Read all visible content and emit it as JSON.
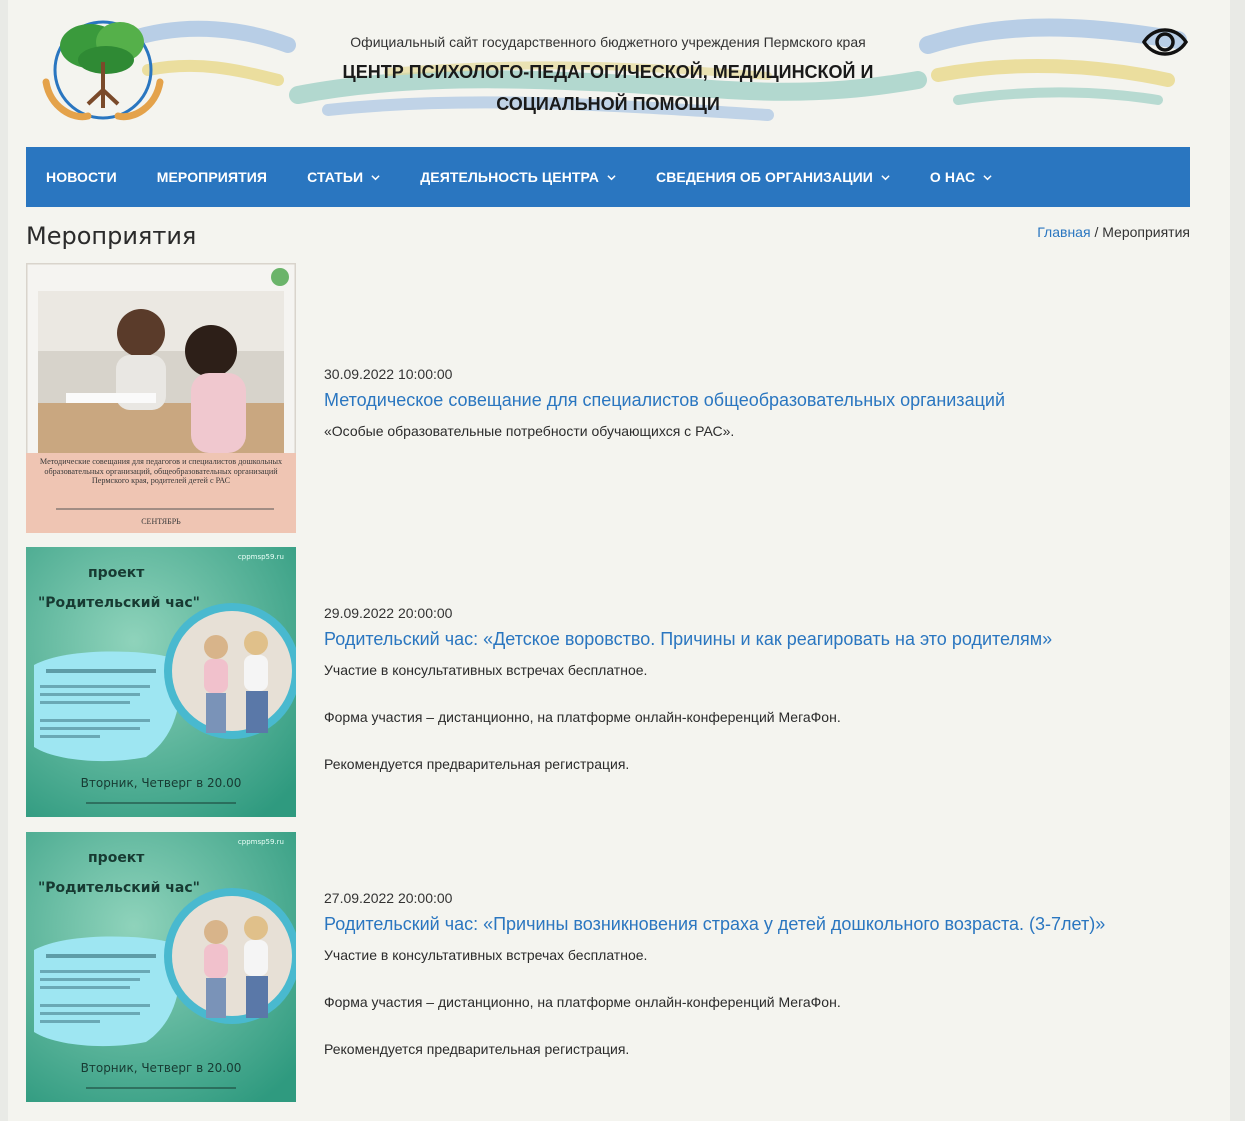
{
  "site": {
    "caption": "Официальный сайт государственного бюджетного учреждения Пермского края",
    "title_line1": "ЦЕНТР ПСИХОЛОГО-ПЕДАГОГИЧЕСКОЙ, МЕДИЦИНСКОЙ И",
    "title_line2": "СОЦИАЛЬНОЙ ПОМОЩИ"
  },
  "nav": {
    "items": [
      {
        "label": "НОВОСТИ"
      },
      {
        "label": "МЕРОПРИЯТИЯ"
      },
      {
        "label": "СТАТЬИ"
      },
      {
        "label": "ДЕЯТЕЛЬНОСТЬ ЦЕНТРА"
      },
      {
        "label": "СВЕДЕНИЯ ОБ ОРГАНИЗАЦИИ"
      },
      {
        "label": "О НАС"
      }
    ]
  },
  "page": {
    "title": "Мероприятия"
  },
  "breadcrumb": {
    "home": "Главная",
    "separator": " / ",
    "current": "Мероприятия"
  },
  "events": [
    {
      "date": "30.09.2022 10:00:00",
      "title": "Методическое совещание для специалистов общеобразовательных организаций",
      "paragraphs": [
        "«Особые образовательные потребности обучающихся с РАС»."
      ],
      "poster": {
        "caption": "Методические совещания для педагогов и специалистов дошкольных образовательных организаций, общеобразовательных организаций Пермского края, родителей детей с РАС",
        "month": "СЕНТЯБРЬ"
      }
    },
    {
      "date": "29.09.2022 20:00:00",
      "title": "Родительский час: «Детское воровство. Причины и как реагировать на это родителям»",
      "paragraphs": [
        "Участие в консультативных встречах бесплатное.",
        "Форма участия – дистанционно, на платформе онлайн-конференций МегаФон.",
        "Рекомендуется предварительная регистрация."
      ],
      "poster": {
        "site": "cppmsp59.ru",
        "word": "проект",
        "project": "\"Родительский час\"",
        "schedule": "Вторник, Четверг в 20.00"
      }
    },
    {
      "date": "27.09.2022 20:00:00",
      "title": "Родительский час: «Причины возникновения страха у детей дошкольного возраста. (3-7лет)»",
      "paragraphs": [
        "Участие в консультативных встречах бесплатное.",
        "Форма участия – дистанционно, на платформе онлайн-конференций МегаФон.",
        "Рекомендуется предварительная регистрация."
      ],
      "poster": {
        "site": "cppmsp59.ru",
        "word": "проект",
        "project": "\"Родительский час\"",
        "schedule": "Вторник, Четверг в 20.00"
      }
    }
  ],
  "colors": {
    "nav": "#2a76c0",
    "link": "#2a76c0",
    "page_bg": "#f4f4ef"
  }
}
